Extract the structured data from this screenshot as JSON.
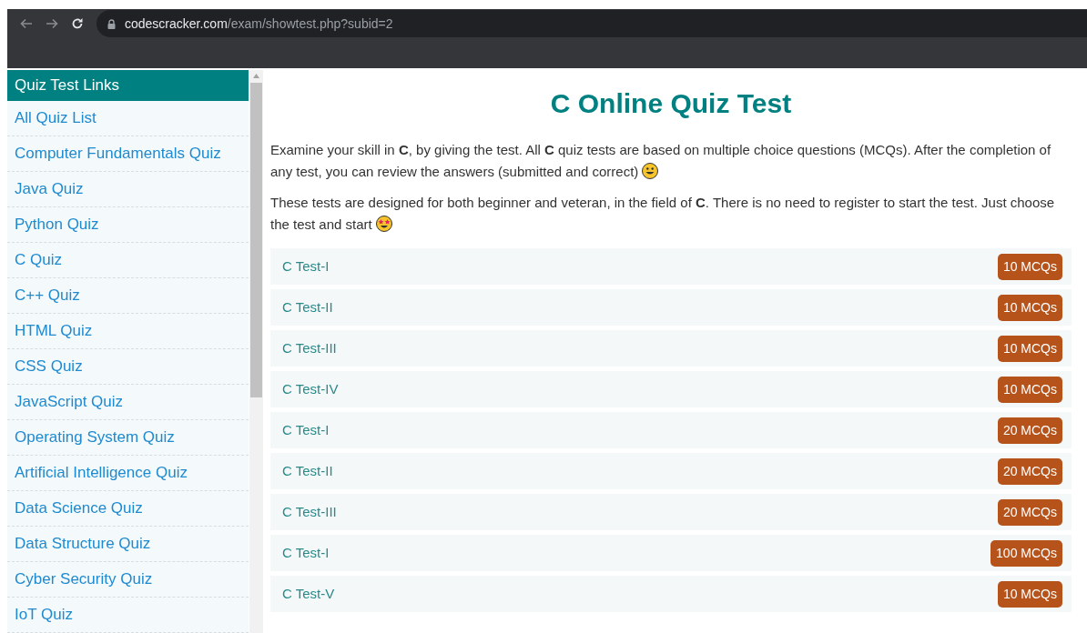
{
  "browser": {
    "domain": "codescracker.com",
    "path": "/exam/showtest.php?subid=2"
  },
  "sidebar": {
    "title": "Quiz Test Links",
    "items": [
      "All Quiz List",
      "Computer Fundamentals Quiz",
      "Java Quiz",
      "Python Quiz",
      "C Quiz",
      "C++ Quiz",
      "HTML Quiz",
      "CSS Quiz",
      "JavaScript Quiz",
      "Operating System Quiz",
      "Artificial Intelligence Quiz",
      "Data Science Quiz",
      "Data Structure Quiz",
      "Cyber Security Quiz",
      "IoT Quiz"
    ]
  },
  "main": {
    "title": "C Online Quiz Test",
    "paragraphs": [
      {
        "text": "Examine your skill in **C**, by giving the test. All **C** quiz tests are based on multiple choice questions (MCQs). After the completion of any test, you can review the answers (submitted and correct)",
        "kind": "grinning"
      },
      {
        "text": "These tests are designed for both beginner and veteran, in the field of **C**. There is no need to register to start the test. Just choose the test and start",
        "kind": "star-eyes"
      }
    ],
    "tests": [
      {
        "name": "C Test-I",
        "count": "10 MCQs"
      },
      {
        "name": "C Test-II",
        "count": "10 MCQs"
      },
      {
        "name": "C Test-III",
        "count": "10 MCQs"
      },
      {
        "name": "C Test-IV",
        "count": "10 MCQs"
      },
      {
        "name": "C Test-I",
        "count": "20 MCQs"
      },
      {
        "name": "C Test-II",
        "count": "20 MCQs"
      },
      {
        "name": "C Test-III",
        "count": "20 MCQs"
      },
      {
        "name": "C Test-I",
        "count": "100 MCQs"
      },
      {
        "name": "C Test-V",
        "count": "10 MCQs"
      }
    ]
  }
}
